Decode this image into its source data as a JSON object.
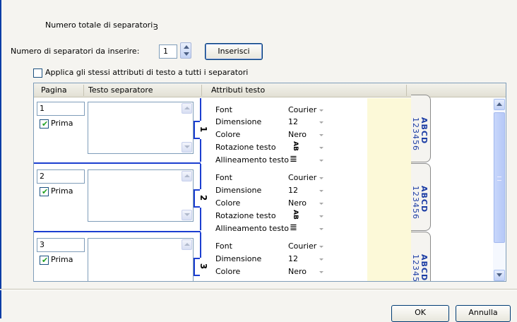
{
  "summary": {
    "total_label": "Numero totale di separatori:",
    "total_value": "3",
    "insert_label": "Numero di separatori da inserire:",
    "insert_value": "1",
    "insert_button": "Inserisci",
    "apply_label": "Applica gli stessi attributi di testo a tutti i separatori",
    "apply_checked": false
  },
  "grid": {
    "columns": [
      "Pagina",
      "Testo separatore",
      "Attributi testo"
    ],
    "rows": [
      {
        "page": "1",
        "first_label": "Prima",
        "first_checked": true,
        "tab_number": "1",
        "attributes": [
          {
            "label": "Font",
            "value": "Courier"
          },
          {
            "label": "Dimensione",
            "value": "12"
          },
          {
            "label": "Colore",
            "value": "Nero"
          },
          {
            "label": "Rotazione testo",
            "value": "AB"
          },
          {
            "label": "Allineamento testo",
            "value": "≣"
          }
        ]
      },
      {
        "page": "2",
        "first_label": "Prima",
        "first_checked": true,
        "tab_number": "2",
        "attributes": [
          {
            "label": "Font",
            "value": "Courier"
          },
          {
            "label": "Dimensione",
            "value": "12"
          },
          {
            "label": "Colore",
            "value": "Nero"
          },
          {
            "label": "Rotazione testo",
            "value": "AB"
          },
          {
            "label": "Allineamento testo",
            "value": "≣"
          }
        ]
      },
      {
        "page": "3",
        "first_label": "Prima",
        "first_checked": true,
        "tab_number": "3",
        "attributes": [
          {
            "label": "Font",
            "value": "Courier"
          },
          {
            "label": "Dimensione",
            "value": "12"
          },
          {
            "label": "Colore",
            "value": "Nero"
          }
        ]
      }
    ],
    "preview_tabs": [
      {
        "line1": "ABCD",
        "line2": "123456"
      },
      {
        "line1": "ABCD",
        "line2": "123456"
      },
      {
        "line1": "ABCD",
        "line2": "12345"
      }
    ]
  },
  "footer": {
    "ok_button": "OK",
    "cancel_button": "Annulla"
  },
  "colors": {
    "accent_blue": "#1c3fd0",
    "preview_yellow": "#fcf9d8",
    "tab_text": "#1d3ea5"
  }
}
